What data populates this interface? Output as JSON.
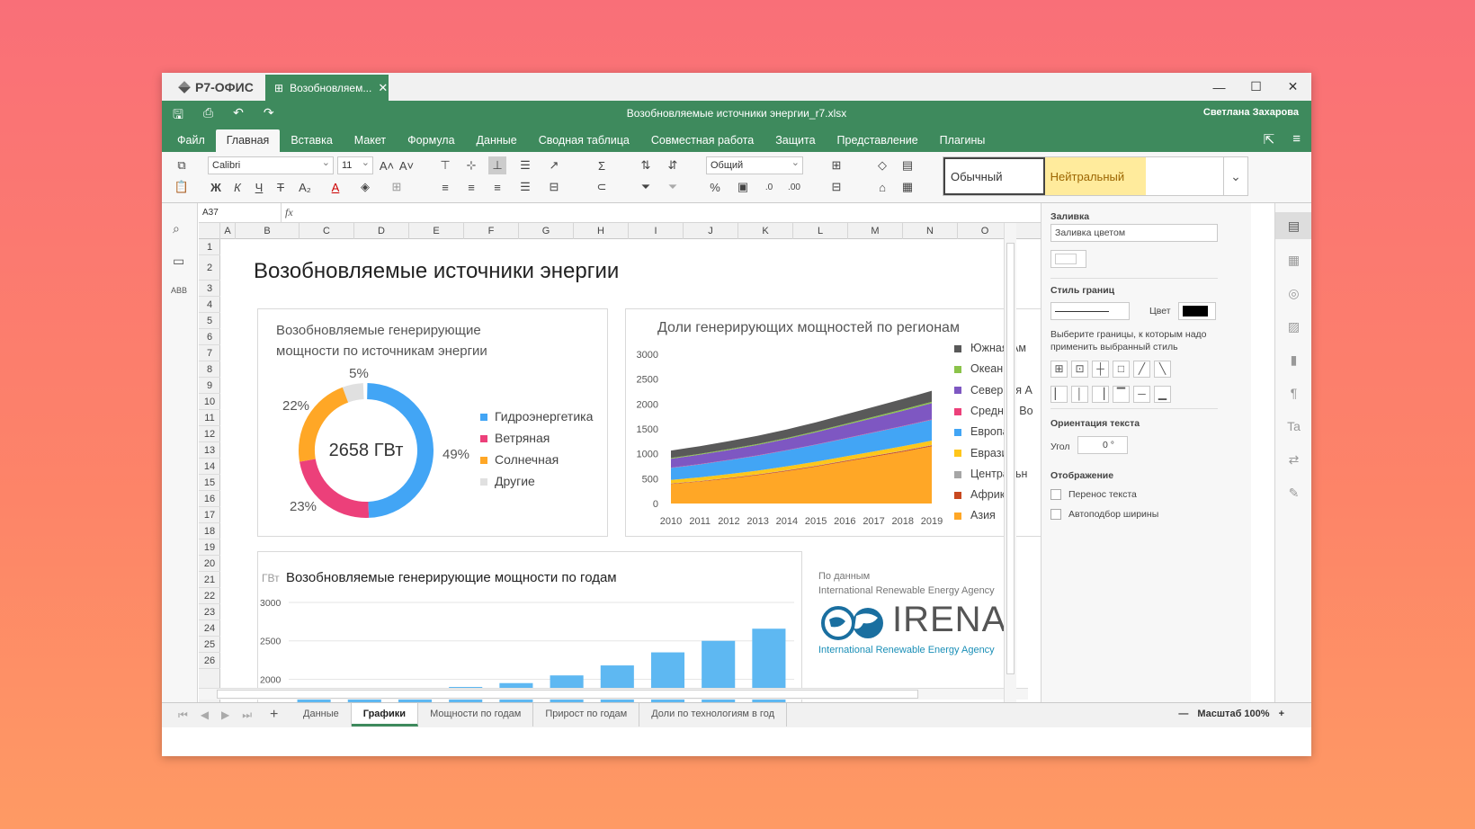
{
  "window": {
    "app_name": "Р7-ОФИС",
    "tab_label": "Возобновляем...",
    "doc_title": "Возобновляемые источники энергии_r7.xlsx",
    "user": "Светлана Захарова"
  },
  "menu": [
    "Файл",
    "Главная",
    "Вставка",
    "Макет",
    "Формула",
    "Данные",
    "Сводная таблица",
    "Совместная работа",
    "Защита",
    "Представление",
    "Плагины"
  ],
  "toolbar": {
    "font_name": "Calibri",
    "font_size": "11",
    "number_format": "Общий",
    "bold": "Ж",
    "italic": "К",
    "underline": "Ч",
    "strike": "Т",
    "subscript": "A₂",
    "styles": [
      "Обычный",
      "Нейтральный"
    ]
  },
  "formula_bar": {
    "cell_ref": "A37",
    "fx": "fx"
  },
  "columns": [
    "A",
    "B",
    "C",
    "D",
    "E",
    "F",
    "G",
    "H",
    "I",
    "J",
    "K",
    "L",
    "M",
    "N",
    "O"
  ],
  "rows": [
    "1",
    "2",
    "3",
    "4",
    "5",
    "6",
    "7",
    "8",
    "9",
    "10",
    "11",
    "12",
    "13",
    "14",
    "15",
    "16",
    "17",
    "18",
    "19",
    "20",
    "21",
    "22",
    "23",
    "24",
    "25",
    "26"
  ],
  "sheet_title": "Возобновляемые источники энергии",
  "donut": {
    "title_line1": "Возобновляемые генерирующие",
    "title_line2": "мощности по источникам энергии",
    "center_label": "2658 ГВт",
    "labels": [
      "49%",
      "23%",
      "22%",
      "5%"
    ]
  },
  "area": {
    "title": "Доли генерирующих мощностей по регионам",
    "y_ticks": [
      "3000",
      "2500",
      "2000",
      "1500",
      "1000",
      "500",
      "0"
    ],
    "x_ticks": [
      "2010",
      "2011",
      "2012",
      "2013",
      "2014",
      "2015",
      "2016",
      "2017",
      "2018",
      "2019"
    ]
  },
  "bar": {
    "unit": "ГВт",
    "title": "Возобновляемые генерирующие мощности по годам",
    "y_ticks": [
      "3000",
      "2500",
      "2000"
    ]
  },
  "source": {
    "line1": "По данным",
    "line2": "International Renewable Energy Agency",
    "logo_text": "IRENA",
    "logo_sub": "International Renewable Energy Agency"
  },
  "chart_data": [
    {
      "type": "pie",
      "title": "Возобновляемые генерирующие мощности по источникам энергии",
      "categories": [
        "Гидроэнергетика",
        "Ветряная",
        "Солнечная",
        "Другие"
      ],
      "values": [
        49,
        23,
        22,
        5
      ],
      "colors": [
        "#42a5f5",
        "#ec407a",
        "#ffa726",
        "#e0e0e0"
      ]
    },
    {
      "type": "area",
      "title": "Доли генерирующих мощностей по регионам",
      "x": [
        2010,
        2011,
        2012,
        2013,
        2014,
        2015,
        2016,
        2017,
        2018,
        2019
      ],
      "ylim": [
        0,
        3000
      ],
      "series": [
        {
          "name": "Азия",
          "color": "#ffa726",
          "values": [
            390,
            440,
            500,
            570,
            650,
            740,
            840,
            940,
            1040,
            1150
          ]
        },
        {
          "name": "Африка",
          "color": "#c8481f",
          "values": [
            10,
            10,
            12,
            12,
            14,
            15,
            16,
            17,
            18,
            19
          ]
        },
        {
          "name": "Центральн",
          "color": "#a6a6a6",
          "values": [
            5,
            5,
            5,
            5,
            6,
            6,
            6,
            6,
            7,
            7
          ]
        },
        {
          "name": "Евразия",
          "color": "#ffc61a",
          "values": [
            70,
            72,
            74,
            76,
            78,
            80,
            82,
            84,
            86,
            88
          ]
        },
        {
          "name": "Европа",
          "color": "#42a5f5",
          "values": [
            240,
            260,
            280,
            300,
            320,
            340,
            360,
            380,
            400,
            420
          ]
        },
        {
          "name": "Средний Во",
          "color": "#ec407a",
          "values": [
            5,
            5,
            5,
            6,
            6,
            6,
            7,
            7,
            8,
            8
          ]
        },
        {
          "name": "Северная А",
          "color": "#7e57c2",
          "values": [
            180,
            190,
            200,
            210,
            225,
            245,
            265,
            285,
            305,
            325
          ]
        },
        {
          "name": "Океания",
          "color": "#8bc34a",
          "values": [
            15,
            16,
            17,
            18,
            19,
            20,
            22,
            24,
            26,
            28
          ]
        },
        {
          "name": "Южная Ам",
          "color": "#595959",
          "values": [
            150,
            155,
            160,
            165,
            170,
            180,
            190,
            200,
            210,
            220
          ]
        }
      ]
    },
    {
      "type": "bar",
      "title": "Возобновляемые генерирующие мощности по годам",
      "ylabel": "ГВт",
      "ylim": [
        1800,
        3000
      ],
      "values": [
        1750,
        1800,
        1850,
        1900,
        1950,
        2050,
        2180,
        2350,
        2500,
        2658
      ],
      "color": "#5eb8f2"
    }
  ],
  "format_panel": {
    "fill_label": "Заливка",
    "fill_value": "Заливка цветом",
    "border_style_label": "Стиль границ",
    "color_label": "Цвет",
    "border_hint": "Выберите границы, к которым надо применить выбранный стиль",
    "orientation_label": "Ориентация текста",
    "angle_label": "Угол",
    "angle_value": "0 °",
    "display_label": "Отображение",
    "wrap_label": "Перенос текста",
    "autofit_label": "Автоподбор ширины"
  },
  "sheets": [
    "Данные",
    "Графики",
    "Мощности по годам",
    "Прирост по годам",
    "Доли по технологиям в год"
  ],
  "zoom": "Масштаб 100%"
}
